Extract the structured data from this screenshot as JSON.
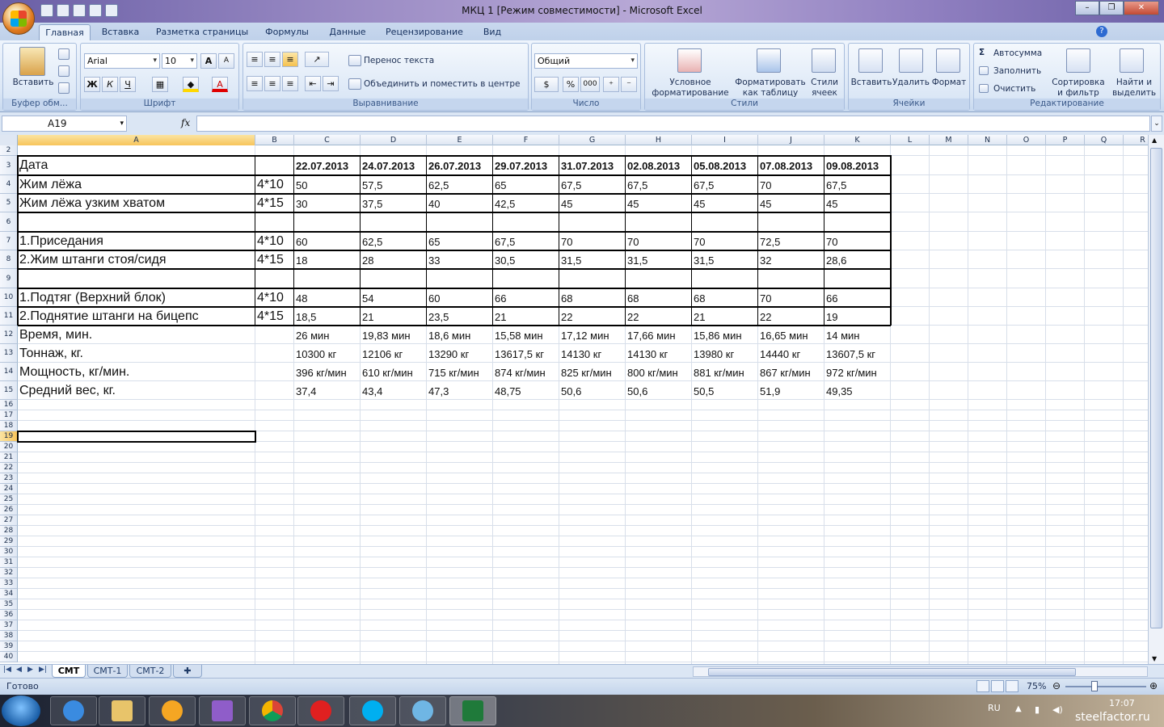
{
  "window": {
    "title": "МКЦ 1  [Режим совместимости] - Microsoft Excel",
    "minimize": "–",
    "restore": "❐",
    "close": "✕"
  },
  "tabs": [
    "Главная",
    "Вставка",
    "Разметка страницы",
    "Формулы",
    "Данные",
    "Рецензирование",
    "Вид"
  ],
  "ribbon": {
    "clipboard": {
      "title": "Буфер обм...",
      "paste": "Вставить"
    },
    "font": {
      "title": "Шрифт",
      "name": "Arial",
      "size": "10",
      "bold": "Ж",
      "italic": "К",
      "underline": "Ч",
      "grow": "A",
      "shrink": "A",
      "color": "A"
    },
    "align": {
      "title": "Выравнивание",
      "wrap": "Перенос текста",
      "merge": "Объединить и поместить в центре"
    },
    "number": {
      "title": "Число",
      "format": "Общий",
      "percent": "%",
      "thousands": "000"
    },
    "styles": {
      "title": "Стили",
      "cond": "Условное форматирование",
      "astable": "Форматировать как таблицу",
      "cellstyles": "Стили ячеек"
    },
    "cells": {
      "title": "Ячейки",
      "insert": "Вставить",
      "delete": "Удалить",
      "format": "Формат"
    },
    "editing": {
      "title": "Редактирование",
      "autosum": "Автосумма",
      "fill": "Заполнить",
      "clear": "Очистить",
      "sort": "Сортировка и фильтр",
      "find": "Найти и выделить"
    }
  },
  "formula_bar": {
    "name_box": "A19",
    "fx": "fx",
    "value": ""
  },
  "columns": [
    "A",
    "B",
    "C",
    "D",
    "E",
    "F",
    "G",
    "H",
    "I",
    "J",
    "K",
    "L",
    "M",
    "N",
    "O",
    "P",
    "Q",
    "R"
  ],
  "sheet": {
    "dates": [
      "Дата",
      "",
      "22.07.2013",
      "24.07.2013",
      "26.07.2013",
      "29.07.2013",
      "31.07.2013",
      "02.08.2013",
      "05.08.2013",
      "07.08.2013",
      "09.08.2013"
    ],
    "r4": [
      "Жим лёжа",
      "4*10",
      "50",
      "57,5",
      "62,5",
      "65",
      "67,5",
      "67,5",
      "67,5",
      "70",
      "67,5"
    ],
    "r5": [
      "Жим лёжа узким хватом",
      "4*15",
      "30",
      "37,5",
      "40",
      "42,5",
      "45",
      "45",
      "45",
      "45",
      "45"
    ],
    "r7": [
      "1.Приседания",
      "4*10",
      "60",
      "62,5",
      "65",
      "67,5",
      "70",
      "70",
      "70",
      "72,5",
      "70"
    ],
    "r8": [
      "2.Жим штанги стоя/сидя",
      "4*15",
      "18",
      "28",
      "33",
      "30,5",
      "31,5",
      "31,5",
      "31,5",
      "32",
      "28,6"
    ],
    "r10": [
      "1.Подтяг (Верхний блок)",
      "4*10",
      "48",
      "54",
      "60",
      "66",
      "68",
      "68",
      "68",
      "70",
      "66"
    ],
    "r11": [
      "2.Поднятие штанги на бицепс",
      "4*15",
      "18,5",
      "21",
      "23,5",
      "21",
      "22",
      "22",
      "21",
      "22",
      "19"
    ],
    "r12": [
      "Время, мин.",
      "",
      "26 мин",
      "19,83 мин",
      "18,6 мин",
      "15,58 мин",
      "17,12 мин",
      "17,66 мин",
      "15,86 мин",
      "16,65 мин",
      "14 мин"
    ],
    "r13": [
      "Тоннаж, кг.",
      "",
      "10300 кг",
      "12106 кг",
      "13290 кг",
      "13617,5 кг",
      "14130 кг",
      "14130 кг",
      "13980 кг",
      "14440 кг",
      "13607,5 кг"
    ],
    "r14": [
      "Мощность, кг/мин.",
      "",
      "396 кг/мин",
      "610 кг/мин",
      "715 кг/мин",
      "874 кг/мин",
      "825 кг/мин",
      "800 кг/мин",
      "881 кг/мин",
      "867 кг/мин",
      "972 кг/мин"
    ],
    "r15": [
      "Средний вес, кг.",
      "",
      "37,4",
      "43,4",
      "47,3",
      "48,75",
      "50,6",
      "50,6",
      "50,5",
      "51,9",
      "49,35"
    ]
  },
  "sheet_tabs": [
    "СМТ",
    "СМТ-1",
    "СМТ-2"
  ],
  "status": {
    "ready": "Готово",
    "zoom": "75%"
  },
  "taskbar": {
    "lang": "RU",
    "time": "17:07",
    "watermark": "steelfactor.ru"
  }
}
